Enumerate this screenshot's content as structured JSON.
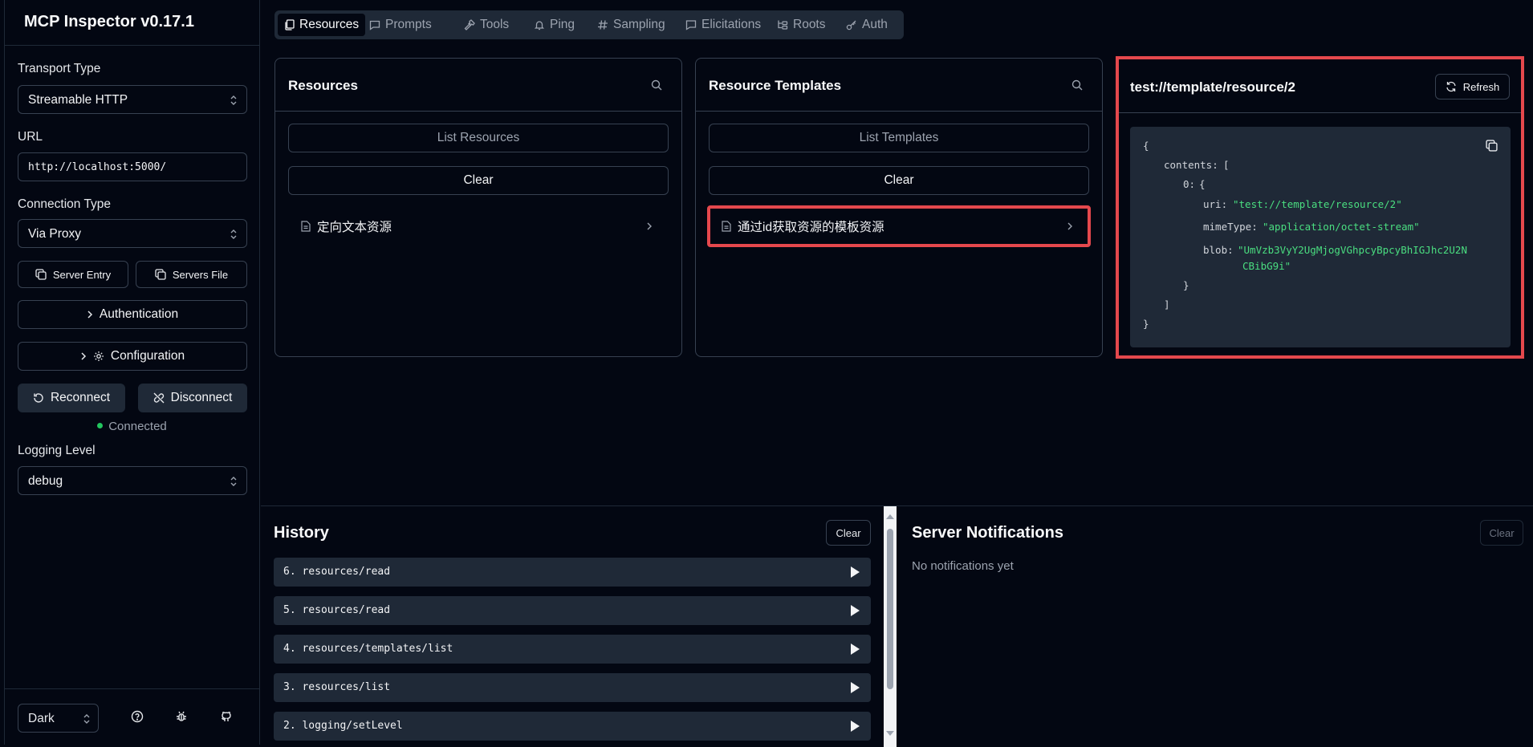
{
  "app": {
    "title": "MCP Inspector v0.17.1"
  },
  "sidebar": {
    "transport_label": "Transport Type",
    "transport_value": "Streamable HTTP",
    "url_label": "URL",
    "url_value": "http://localhost:5000/",
    "connection_label": "Connection Type",
    "connection_value": "Via Proxy",
    "server_entry_label": "Server Entry",
    "servers_file_label": "Servers File",
    "authentication_label": "Authentication",
    "configuration_label": "Configuration",
    "reconnect_label": "Reconnect",
    "disconnect_label": "Disconnect",
    "status_text": "Connected",
    "logging_label": "Logging Level",
    "logging_value": "debug",
    "theme_value": "Dark"
  },
  "tabs": [
    {
      "label": "Resources",
      "icon": "files-icon",
      "active": true
    },
    {
      "label": "Prompts",
      "icon": "message-square-icon",
      "active": false
    },
    {
      "label": "Tools",
      "icon": "hammer-icon",
      "active": false
    },
    {
      "label": "Ping",
      "icon": "bell-icon",
      "active": false
    },
    {
      "label": "Sampling",
      "icon": "hash-icon",
      "active": false
    },
    {
      "label": "Elicitations",
      "icon": "message-circle-icon",
      "active": false
    },
    {
      "label": "Roots",
      "icon": "folder-tree-icon",
      "active": false
    },
    {
      "label": "Auth",
      "icon": "key-icon",
      "active": false
    }
  ],
  "resources": {
    "title": "Resources",
    "list_button": "List Resources",
    "clear_button": "Clear",
    "items": [
      "定向文本资源"
    ]
  },
  "templates": {
    "title": "Resource Templates",
    "list_button": "List Templates",
    "clear_button": "Clear",
    "items": [
      "通过id获取资源的模板资源"
    ]
  },
  "detail": {
    "title": "test://template/resource/2",
    "refresh_label": "Refresh",
    "json": {
      "open": "{",
      "contents_key": "contents:",
      "contents_open": "[",
      "index_key": "0:",
      "index_open": "{",
      "uri_key": "uri:",
      "uri_value": "\"test://template/resource/2\"",
      "mime_key": "mimeType:",
      "mime_value": "\"application/octet-stream\"",
      "blob_key": "blob:",
      "blob_value_1": "\"UmVzb3VyY2UgMjogVGhpcyBpcyBhIGJhc2U2N",
      "blob_value_2": "CBibG9i\"",
      "index_close": "}",
      "contents_close": "]",
      "close": "}"
    }
  },
  "history": {
    "title": "History",
    "clear_label": "Clear",
    "items": [
      "6. resources/read",
      "5. resources/read",
      "4. resources/templates/list",
      "3. resources/list",
      "2. logging/setLevel"
    ]
  },
  "notifications": {
    "title": "Server Notifications",
    "clear_label": "Clear",
    "empty_text": "No notifications yet"
  },
  "colors": {
    "background": "#030712",
    "border": "#374151",
    "highlight": "#e5484d",
    "connected": "#22c55e",
    "json_string": "#4ade80"
  }
}
